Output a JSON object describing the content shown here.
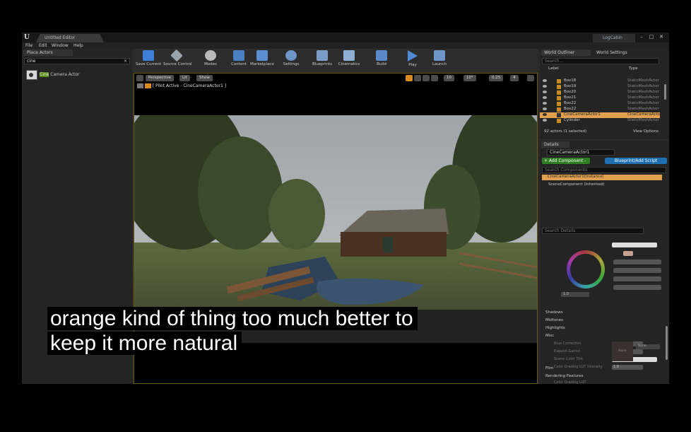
{
  "window": {
    "doc_tab": "Untitled Editor",
    "project_tab": "LogCabin",
    "controls": [
      "–",
      "□",
      "✕"
    ]
  },
  "menu": [
    "File",
    "Edit",
    "Window",
    "Help"
  ],
  "place_actors": {
    "tab": "Place Actors",
    "search_value": "cine",
    "result_highlight": "Cine",
    "result_rest": " Camera Actor"
  },
  "toolbar": [
    {
      "label": "Save Current",
      "icon": "save-icon",
      "color": "#3d7fd4"
    },
    {
      "label": "Source Control",
      "icon": "source-control-icon",
      "color": "#9aa4ad"
    },
    {
      "label": "Modes",
      "icon": "modes-icon",
      "color": "#b9b9b9"
    },
    {
      "label": "Content",
      "icon": "content-icon",
      "color": "#4a7fc1"
    },
    {
      "label": "Marketplace",
      "icon": "marketplace-icon",
      "color": "#5a8ed0"
    },
    {
      "label": "Settings",
      "icon": "settings-icon",
      "color": "#6d95c6"
    },
    {
      "label": "Blueprints",
      "icon": "blueprints-icon",
      "color": "#7a9cc6"
    },
    {
      "label": "Cinematics",
      "icon": "cinematics-icon",
      "color": "#8faed3"
    },
    {
      "label": "Build",
      "icon": "build-icon",
      "color": "#5b88c8"
    },
    {
      "label": "Play",
      "icon": "play-icon",
      "color": "#4e8ad6"
    },
    {
      "label": "Launch",
      "icon": "launch-icon",
      "color": "#6d95c6"
    }
  ],
  "viewport": {
    "buttons": [
      "Perspective",
      "Lit",
      "Show"
    ],
    "pilot": "[ Pilot Active - CineCameraActor1 ]",
    "right_values": [
      "10",
      "10°",
      "0.25",
      "4"
    ]
  },
  "subtitle": [
    "orange kind of thing too much better to",
    "keep it more natural"
  ],
  "outliner": {
    "tabs": [
      "World Outliner",
      "World Settings"
    ],
    "search_placeholder": "Search...",
    "col_label": "Label",
    "col_type": "Type",
    "rows": [
      {
        "name": "Box18",
        "type": "StaticMeshActor"
      },
      {
        "name": "Box19",
        "type": "StaticMeshActor"
      },
      {
        "name": "Box20",
        "type": "StaticMeshActor"
      },
      {
        "name": "Box21",
        "type": "StaticMeshActor"
      },
      {
        "name": "Box22",
        "type": "StaticMeshActor"
      },
      {
        "name": "Box22",
        "type": "StaticMeshActor"
      },
      {
        "name": "CineCameraActor1",
        "type": "CineCameraActor",
        "selected": true
      },
      {
        "name": "Cylinder",
        "type": "StaticMeshActor"
      }
    ],
    "footer": "92 actors (1 selected)",
    "view_options": "View Options"
  },
  "details": {
    "tab": "Details",
    "actor_name": "CineCameraActor1",
    "add_component": "+ Add Component -",
    "blueprint_script": "Blueprint/Add Script",
    "search_components": "Search Components",
    "instance": "CineCameraActor1(Instance)",
    "scene_component": "SceneComponent (Inherited)",
    "search_details": "Search Details",
    "color_value": "1.0",
    "categories": [
      "Shadows",
      "Midtones",
      "Highlights",
      "Misc"
    ],
    "misc_items": [
      "Blue Correction",
      "Expand Gamut",
      "Scene Color Tint",
      "Color Grading LUT Intensity",
      "Color Grading LUT"
    ],
    "misc_values": [
      "0.0",
      "1.0",
      "",
      "1.0"
    ],
    "lut_none": "None",
    "lut_combo": "None",
    "bottom_categories": [
      "Film",
      "Rendering Features"
    ]
  }
}
